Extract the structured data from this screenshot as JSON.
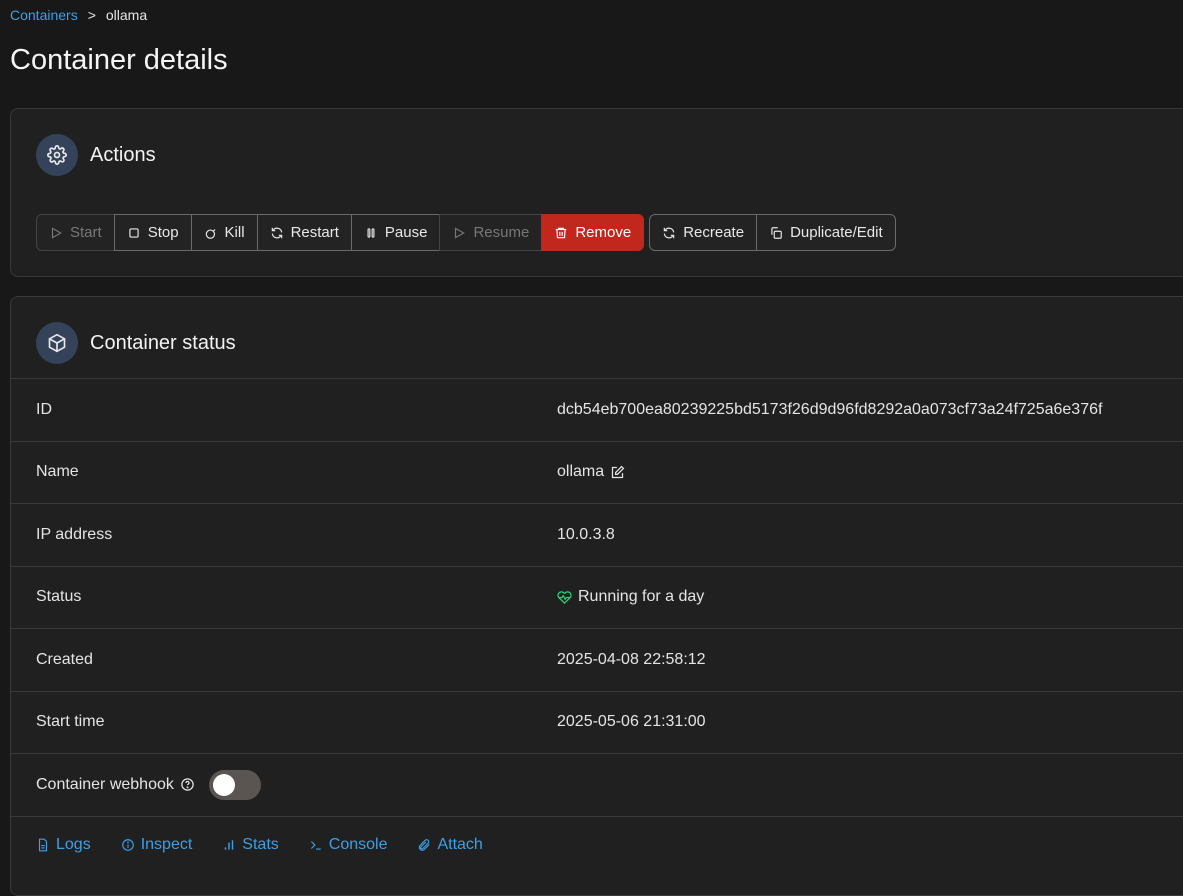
{
  "breadcrumb": {
    "parent": "Containers",
    "separator": ">",
    "current": "ollama"
  },
  "page": {
    "title": "Container details"
  },
  "actions": {
    "title": "Actions",
    "buttons_primary": [
      {
        "label": "Start",
        "icon": "play-icon",
        "state": "disabled"
      },
      {
        "label": "Stop",
        "icon": "stop-icon",
        "state": "enabled"
      },
      {
        "label": "Kill",
        "icon": "bomb-icon",
        "state": "enabled"
      },
      {
        "label": "Restart",
        "icon": "refresh-icon",
        "state": "enabled"
      },
      {
        "label": "Pause",
        "icon": "pause-icon",
        "state": "enabled"
      },
      {
        "label": "Resume",
        "icon": "play-icon",
        "state": "disabled"
      },
      {
        "label": "Remove",
        "icon": "trash-icon",
        "state": "danger"
      }
    ],
    "buttons_secondary": [
      {
        "label": "Recreate",
        "icon": "refresh-icon"
      },
      {
        "label": "Duplicate/Edit",
        "icon": "copy-icon"
      }
    ]
  },
  "status": {
    "title": "Container status",
    "rows": {
      "id": {
        "label": "ID",
        "value": "dcb54eb700ea80239225bd5173f26d9d96fd8292a0a073cf73a24f725a6e376f"
      },
      "name": {
        "label": "Name",
        "value": "ollama"
      },
      "ip": {
        "label": "IP address",
        "value": "10.0.3.8"
      },
      "state": {
        "label": "Status",
        "value": "Running for a day"
      },
      "created": {
        "label": "Created",
        "value": "2025-04-08 22:58:12"
      },
      "start_time": {
        "label": "Start time",
        "value": "2025-05-06 21:31:00"
      },
      "webhook": {
        "label": "Container webhook",
        "enabled": false
      }
    },
    "links": {
      "logs": "Logs",
      "inspect": "Inspect",
      "stats": "Stats",
      "console": "Console",
      "attach": "Attach"
    }
  },
  "colors": {
    "accent": "#3ba0e6",
    "danger": "#c2271e",
    "healthy": "#2ecc71",
    "icon_badge": "#35435a"
  }
}
